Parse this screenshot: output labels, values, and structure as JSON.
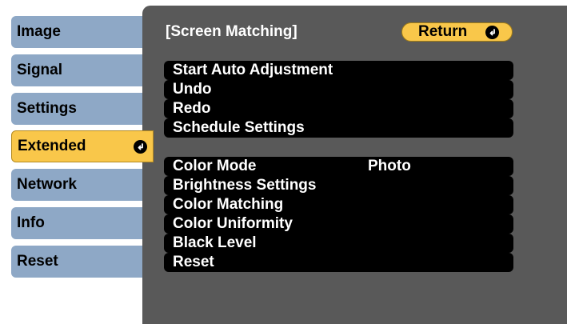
{
  "sidebar": {
    "items": [
      {
        "label": "Image"
      },
      {
        "label": "Signal"
      },
      {
        "label": "Settings"
      },
      {
        "label": "Extended",
        "selected": true
      },
      {
        "label": "Network"
      },
      {
        "label": "Info"
      },
      {
        "label": "Reset"
      }
    ]
  },
  "panel": {
    "title": "[Screen Matching]",
    "return_label": "Return"
  },
  "menu": {
    "group1": [
      {
        "label": "Start Auto Adjustment"
      },
      {
        "label": "Undo"
      },
      {
        "label": "Redo"
      },
      {
        "label": "Schedule Settings"
      }
    ],
    "group2": [
      {
        "label": "Color Mode",
        "value": "Photo"
      },
      {
        "label": "Brightness Settings"
      },
      {
        "label": "Color Matching"
      },
      {
        "label": "Color Uniformity"
      },
      {
        "label": "Black Level"
      },
      {
        "label": "Reset"
      }
    ]
  },
  "colors": {
    "tab_bg": "#8ea8c6",
    "selected_bg": "#f9c74a",
    "panel_bg": "#595959",
    "row_bg": "#000000",
    "text_light": "#ffffff"
  },
  "icons": {
    "enter": "enter-icon"
  }
}
